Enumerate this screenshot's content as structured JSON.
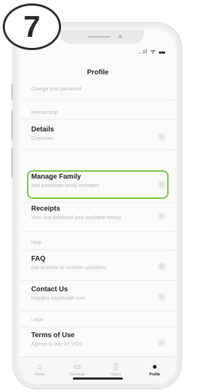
{
  "step": {
    "number": "7"
  },
  "status": {
    "icons": "..ıl ᯤ ▬"
  },
  "header": {
    "title": "Profile"
  },
  "rows": {
    "change_password": "Change your password",
    "membership_section": "Membership",
    "details": {
      "title": "Details",
      "subtitle": "Corporate"
    },
    "manage_family": {
      "title": "Manage Family",
      "subtitle": "Add immediate family members"
    },
    "receipts": {
      "title": "Receipts",
      "subtitle": "View and download your purchase history"
    },
    "help_section": "Help",
    "faq": {
      "title": "FAQ",
      "subtitle": "Get answers to common questions"
    },
    "contact": {
      "title": "Contact Us",
      "subtitle": "help@vc.tcluxhealth.com"
    },
    "legal_section": "Legal",
    "terms": {
      "title": "Terms of Use",
      "subtitle": "Agreed to July 22, 2021"
    }
  },
  "chevron": "›",
  "tabs": [
    {
      "icon": "home-icon",
      "glyph": "⌂",
      "label": "Home"
    },
    {
      "icon": "chat-icon",
      "glyph": "▭",
      "label": "Concierge"
    },
    {
      "icon": "document-icon",
      "glyph": "▯",
      "label": "History"
    },
    {
      "icon": "person-icon",
      "glyph": "●",
      "label": "Profile"
    }
  ],
  "colors": {
    "highlight": "#7ac143",
    "text": "#222222",
    "muted": "#b7b7b7"
  }
}
